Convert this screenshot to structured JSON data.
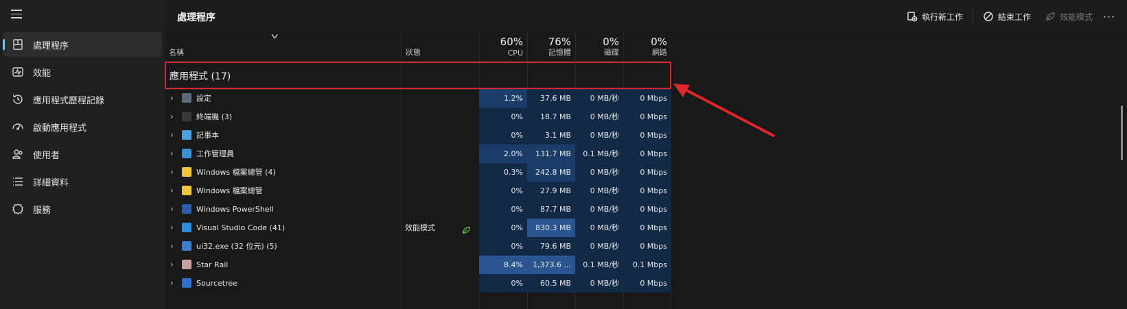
{
  "app": {
    "page_title": "處理程序"
  },
  "sidebar": {
    "items": [
      {
        "label": "處理程序",
        "icon": "processes-icon",
        "active": true
      },
      {
        "label": "效能",
        "icon": "performance-icon",
        "active": false
      },
      {
        "label": "應用程式歷程記錄",
        "icon": "history-icon",
        "active": false
      },
      {
        "label": "啟動應用程式",
        "icon": "startup-icon",
        "active": false
      },
      {
        "label": "使用者",
        "icon": "users-icon",
        "active": false
      },
      {
        "label": "詳細資料",
        "icon": "details-icon",
        "active": false
      },
      {
        "label": "服務",
        "icon": "services-icon",
        "active": false
      }
    ]
  },
  "toolbar": {
    "run_new_task": "執行新工作",
    "end_task": "結束工作",
    "efficiency_mode": "效能模式",
    "more": "···"
  },
  "table": {
    "headers": {
      "name": "名稱",
      "status": "狀態",
      "cpu_pct": "60%",
      "cpu": "CPU",
      "mem_pct": "76%",
      "mem": "記憶體",
      "disk_pct": "0%",
      "disk": "磁碟",
      "net_pct": "0%",
      "net": "網路"
    },
    "group_label": "應用程式 (17)",
    "rows": [
      {
        "name": "設定",
        "status": "",
        "cpu": "1.2%",
        "mem": "37.6 MB",
        "disk": "0 MB/秒",
        "net": "0 Mbps",
        "icon": "gear-icon",
        "icon_color": "#5a6b7d",
        "leaf": false
      },
      {
        "name": "終端機 (3)",
        "status": "",
        "cpu": "0%",
        "mem": "18.7 MB",
        "disk": "0 MB/秒",
        "net": "0 Mbps",
        "icon": "terminal-icon",
        "icon_color": "#3a3a3a",
        "leaf": false
      },
      {
        "name": "記事本",
        "status": "",
        "cpu": "0%",
        "mem": "3.1 MB",
        "disk": "0 MB/秒",
        "net": "0 Mbps",
        "icon": "notepad-icon",
        "icon_color": "#4aa3df",
        "leaf": false
      },
      {
        "name": "工作管理員",
        "status": "",
        "cpu": "2.0%",
        "mem": "131.7 MB",
        "disk": "0.1 MB/秒",
        "net": "0 Mbps",
        "icon": "task-manager-icon",
        "icon_color": "#3c8fd6",
        "leaf": false
      },
      {
        "name": "Windows 檔案總管 (4)",
        "status": "",
        "cpu": "0.3%",
        "mem": "242.8 MB",
        "disk": "0 MB/秒",
        "net": "0 Mbps",
        "icon": "folder-icon",
        "icon_color": "#f2c43d",
        "leaf": false
      },
      {
        "name": "Windows 檔案總管",
        "status": "",
        "cpu": "0%",
        "mem": "27.9 MB",
        "disk": "0 MB/秒",
        "net": "0 Mbps",
        "icon": "folder-icon",
        "icon_color": "#f2c43d",
        "leaf": false
      },
      {
        "name": "Windows PowerShell",
        "status": "",
        "cpu": "0%",
        "mem": "87.7 MB",
        "disk": "0 MB/秒",
        "net": "0 Mbps",
        "icon": "powershell-icon",
        "icon_color": "#2a5fb0",
        "leaf": false
      },
      {
        "name": "Visual Studio Code (41)",
        "status": "效能模式",
        "cpu": "0%",
        "mem": "830.3 MB",
        "disk": "0 MB/秒",
        "net": "0 Mbps",
        "icon": "vscode-icon",
        "icon_color": "#2b8fe0",
        "leaf": true
      },
      {
        "name": "ui32.exe (32 位元) (5)",
        "status": "",
        "cpu": "0%",
        "mem": "79.6 MB",
        "disk": "0 MB/秒",
        "net": "0 Mbps",
        "icon": "app-icon",
        "icon_color": "#3a7fd0",
        "leaf": false
      },
      {
        "name": "Star Rail",
        "status": "",
        "cpu": "8.4%",
        "mem": "1,373.6 ...",
        "disk": "0.1 MB/秒",
        "net": "0.1 Mbps",
        "icon": "game-icon",
        "icon_color": "#c9a0a0",
        "leaf": false
      },
      {
        "name": "Sourcetree",
        "status": "",
        "cpu": "0%",
        "mem": "60.5 MB",
        "disk": "0 MB/秒",
        "net": "0 Mbps",
        "icon": "sourcetree-icon",
        "icon_color": "#2e6fd6",
        "leaf": false
      }
    ]
  },
  "colors": {
    "highlight_border": "#e0262b",
    "heat_low": "#132a47",
    "heat_mid": "#1c3d6a",
    "heat_high": "#2a5591"
  }
}
